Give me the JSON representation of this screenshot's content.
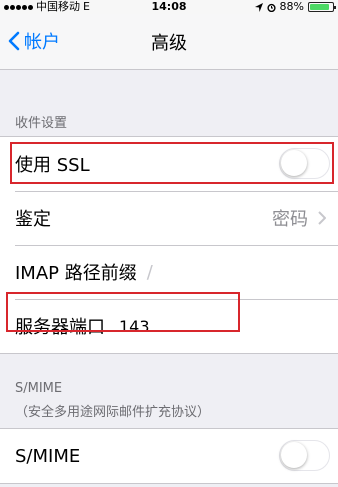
{
  "status_bar": {
    "carrier": "中国移动",
    "network": "E",
    "time": "14:08",
    "battery": "88%",
    "battery_level": 0.88
  },
  "nav": {
    "back_label": "帐户",
    "title": "高级"
  },
  "incoming": {
    "header": "收件设置",
    "ssl_label": "使用 SSL",
    "ssl_enabled": false,
    "auth_label": "鉴定",
    "auth_value": "密码",
    "imap_prefix_label": "IMAP 路径前缀",
    "imap_prefix_placeholder": "/",
    "port_label": "服务器端口",
    "port_value": "143"
  },
  "smime": {
    "header": "S/MIME",
    "subheader": "（安全多用途网际邮件扩充协议）",
    "label": "S/MIME",
    "enabled": false
  },
  "colors": {
    "accent": "#007aff",
    "highlight": "#d8262c",
    "battery": "#4cd964"
  }
}
